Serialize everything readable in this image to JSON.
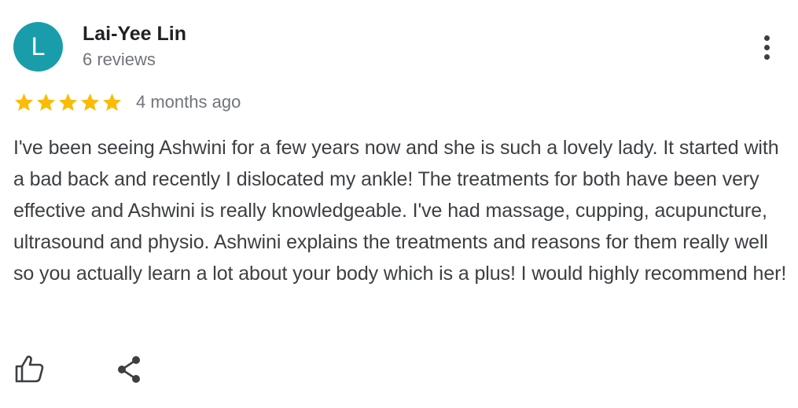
{
  "review": {
    "author": {
      "initial": "L",
      "name": "Lai-Yee Lin",
      "review_count": "6 reviews",
      "avatar_color": "#1a9dab"
    },
    "rating": {
      "stars": 5,
      "max_stars": 5,
      "star_color": "#fbbc04"
    },
    "date": "4 months ago",
    "text": "I've been seeing Ashwini for a few years now and she is such a lovely lady. It started with a bad back and recently I dislocated my ankle! The treatments for both have been very effective and Ashwini is really knowledgeable. I've had massage, cupping, acupuncture, ultrasound and physio. Ashwini explains the treatments and reasons for them really well so you actually learn a lot about your body which is a plus! I would highly recommend her!",
    "icons": {
      "more": "more-vert-icon",
      "like": "thumb-up-icon",
      "share": "share-icon"
    }
  }
}
